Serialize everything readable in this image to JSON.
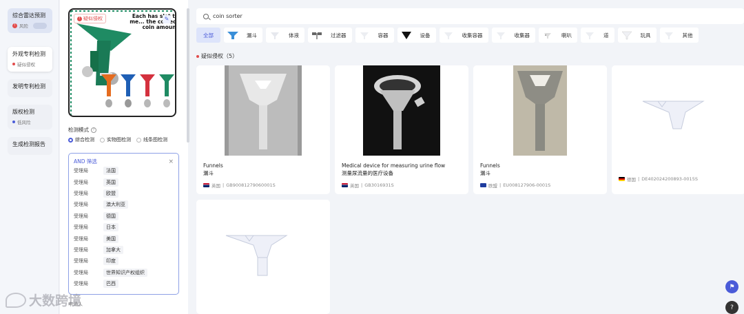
{
  "nav": {
    "items": [
      {
        "title": "综合雷达预测",
        "sub": "风险"
      },
      {
        "title": "外观专利检测",
        "sub": "疑似侵权"
      },
      {
        "title": "发明专利检测",
        "sub": ""
      },
      {
        "title": "版权检测",
        "sub": "低风险"
      },
      {
        "title": "生成检测报告",
        "sub": ""
      }
    ]
  },
  "thumbnail": {
    "tag": "疑似侵权",
    "caption": "Each has slot to me... the correct coin amount"
  },
  "mode": {
    "title": "检测模式",
    "options": [
      "综合检测",
      "实物图检测",
      "线条图检测"
    ],
    "selected": "综合检测"
  },
  "filter": {
    "header": "AND  筛选",
    "rows": [
      {
        "k": "受理局",
        "v": "法国"
      },
      {
        "k": "受理局",
        "v": "英国"
      },
      {
        "k": "受理局",
        "v": "欧盟"
      },
      {
        "k": "受理局",
        "v": "澳大利亚"
      },
      {
        "k": "受理局",
        "v": "德国"
      },
      {
        "k": "受理局",
        "v": "日本"
      },
      {
        "k": "受理局",
        "v": "美国"
      },
      {
        "k": "受理局",
        "v": "加拿大"
      },
      {
        "k": "受理局",
        "v": "印度"
      },
      {
        "k": "受理局",
        "v": "世界知识产权组织"
      },
      {
        "k": "受理局",
        "v": "巴西"
      }
    ],
    "next_label": "申请人"
  },
  "watermark": "大数跨境",
  "search": {
    "value": "coin sorter"
  },
  "categories": [
    {
      "label": "全部",
      "icon": ""
    },
    {
      "label": "漏斗",
      "icon": "funnel-icon"
    },
    {
      "label": "体液",
      "icon": "liquid-icon"
    },
    {
      "label": "过滤器",
      "icon": "filter-icon"
    },
    {
      "label": "容器",
      "icon": "container-icon"
    },
    {
      "label": "设备",
      "icon": "device-icon"
    },
    {
      "label": "收集容器",
      "icon": "collect-container-icon"
    },
    {
      "label": "收集器",
      "icon": "collector-icon"
    },
    {
      "label": "喇叭",
      "icon": "horn-icon"
    },
    {
      "label": "道",
      "icon": "channel-icon"
    },
    {
      "label": "玩具",
      "icon": "toy-icon"
    },
    {
      "label": "其他",
      "icon": "other-icon"
    }
  ],
  "section": {
    "title": "疑似侵权（5）"
  },
  "results": [
    {
      "en": "Funnels",
      "cn": "漏斗",
      "country": "英国",
      "number": "GB90081279060001S"
    },
    {
      "en": "Medical device for measuring urine flow",
      "cn": "测量尿流量的医疗设备",
      "country": "英国",
      "number": "GB3016931S"
    },
    {
      "en": "Funnels",
      "cn": "漏斗",
      "country": "欧盟",
      "number": "EU008127906-0001S"
    },
    {
      "en": "",
      "cn": "",
      "country": "德国",
      "number": "DE402024200893-0015S"
    },
    {
      "en": "",
      "cn": "",
      "country": "",
      "number": ""
    }
  ],
  "colors": {
    "accent": "#4a5bd8",
    "danger": "#e24c4c"
  }
}
